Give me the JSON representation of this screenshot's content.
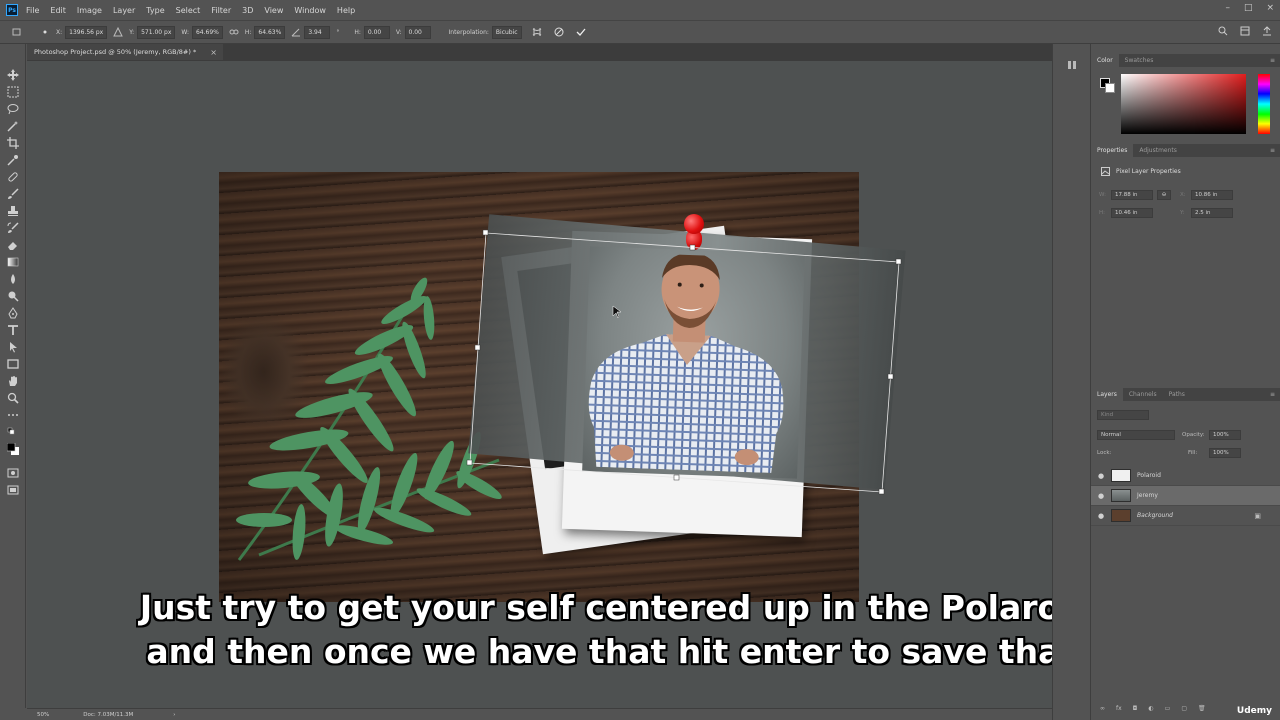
{
  "app": {
    "logo_text": "Ps",
    "menu": [
      "File",
      "Edit",
      "Image",
      "Layer",
      "Type",
      "Select",
      "Filter",
      "3D",
      "View",
      "Window",
      "Help"
    ],
    "window_controls": [
      "–",
      "□",
      "×"
    ]
  },
  "options_bar": {
    "x_label": "X:",
    "x_value": "1396.56 px",
    "y_label": "Y:",
    "y_value": "571.00 px",
    "w_label": "W:",
    "w_value": "64.69%",
    "h_label": "H:",
    "h_value": "64.63%",
    "angle_value": "3.94",
    "angle_unit": "°",
    "hskew_label": "H:",
    "hskew_value": "0.00",
    "vskew_label": "V:",
    "vskew_value": "0.00",
    "interpolation_label": "Interpolation:",
    "interpolation_value": "Bicubic"
  },
  "document": {
    "tab_title": "Photoshop Project.psd @ 50% (Jeremy, RGB/8#) *",
    "close_glyph": "×"
  },
  "subtitle": {
    "line1": "Just try to get your self centered up in the Polaroid",
    "line2": "and then once we have that hit enter to save that."
  },
  "status_bar": {
    "zoom": "50%",
    "doc_size": "Doc: 7.03M/11.3M",
    "arrow": "›"
  },
  "color_panel": {
    "tabs": [
      "Color",
      "Swatches"
    ],
    "active_tab": "Color"
  },
  "properties_panel": {
    "tabs": [
      "Properties",
      "Adjustments"
    ],
    "header": "Pixel Layer Properties",
    "w_label": "W:",
    "w_value": "17.88 in",
    "x_label": "X:",
    "x_value": "10.86 in",
    "h_label": "H:",
    "h_value": "10.46 in",
    "y_label": "Y:",
    "y_value": "2.5 in",
    "link_glyph": "⊖"
  },
  "layers_panel": {
    "tabs": [
      "Layers",
      "Channels",
      "Paths"
    ],
    "filter_placeholder": "Kind",
    "blend_mode": "Normal",
    "opacity_label": "Opacity:",
    "opacity_value": "100%",
    "lock_label": "Lock:",
    "fill_label": "Fill:",
    "fill_value": "100%",
    "layers": [
      {
        "name": "Polaroid",
        "selected": false
      },
      {
        "name": "Jeremy",
        "selected": true
      },
      {
        "name": "Background",
        "selected": false,
        "locked": true
      }
    ]
  },
  "watermark": "Udemy",
  "colors": {
    "ui_background": "#535353",
    "canvas_background": "#4e5151",
    "selection": "#6a6a6a",
    "pushpin": "#e01010",
    "subtitle_text": "#ffffff"
  },
  "icons": [
    "move-icon",
    "marquee-icon",
    "lasso-icon",
    "magic-wand-icon",
    "crop-icon",
    "eyedropper-icon",
    "healing-icon",
    "brush-icon",
    "stamp-icon",
    "history-brush-icon",
    "eraser-icon",
    "gradient-icon",
    "blur-icon",
    "dodge-icon",
    "pen-icon",
    "type-icon",
    "path-select-icon",
    "rectangle-icon",
    "hand-icon",
    "zoom-icon",
    "more-icon",
    "search-icon",
    "workspace-icon",
    "cancel-icon",
    "commit-icon",
    "eye-icon",
    "lock-icon"
  ]
}
